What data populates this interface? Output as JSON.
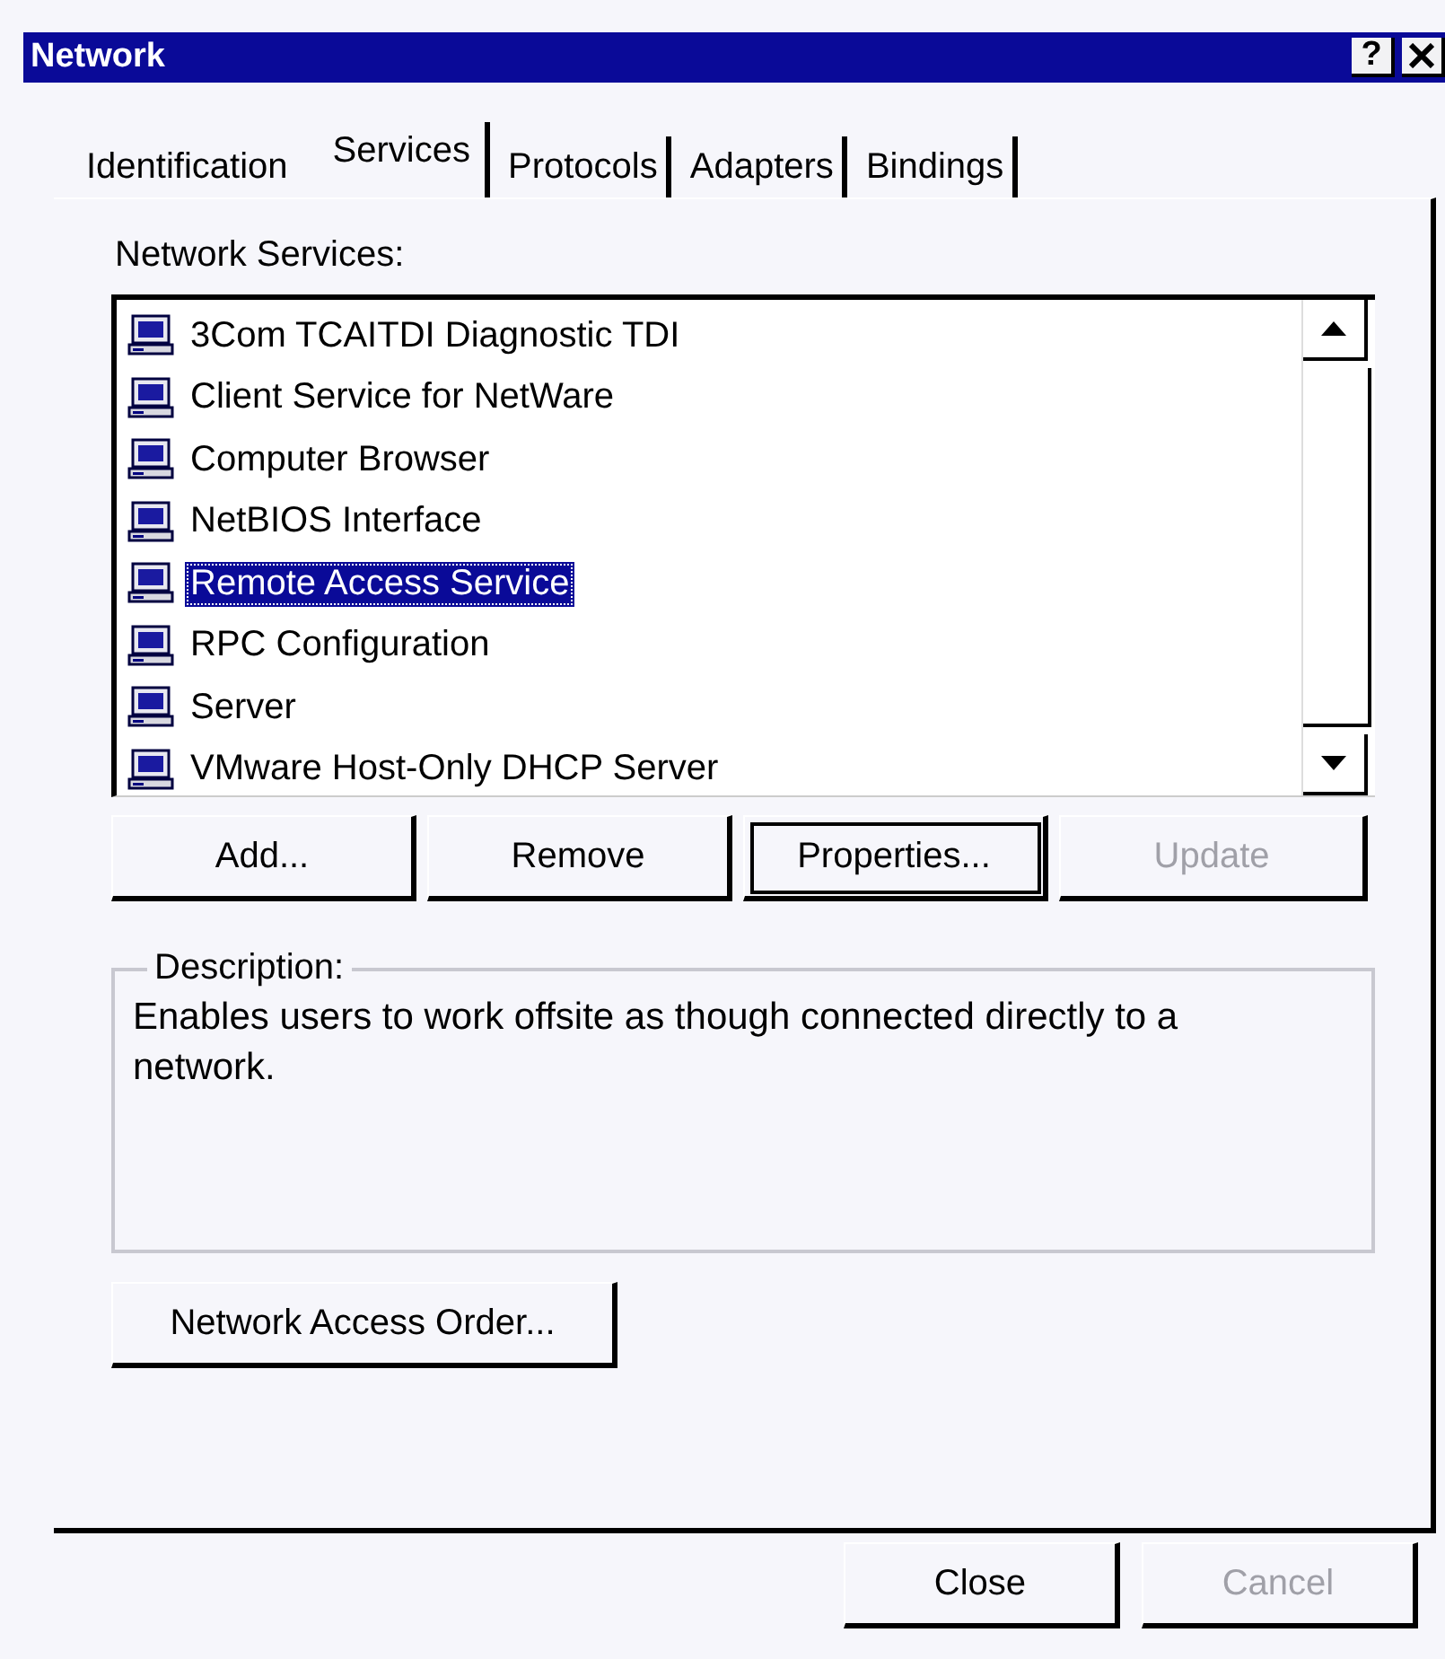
{
  "window": {
    "title": "Network",
    "title_buttons": [
      {
        "kind": "help",
        "label": "?"
      },
      {
        "kind": "close"
      }
    ]
  },
  "tabs": [
    {
      "label": "Identification",
      "selected": false
    },
    {
      "label": "Services",
      "selected": true
    },
    {
      "label": "Protocols",
      "selected": false
    },
    {
      "label": "Adapters",
      "selected": false
    },
    {
      "label": "Bindings",
      "selected": false
    }
  ],
  "services": {
    "label": "Network Services:",
    "items": [
      {
        "name": "3Com TCAITDI Diagnostic TDI",
        "selected": false
      },
      {
        "name": "Client Service for NetWare",
        "selected": false
      },
      {
        "name": "Computer Browser",
        "selected": false
      },
      {
        "name": "NetBIOS Interface",
        "selected": false
      },
      {
        "name": "Remote Access Service",
        "selected": true
      },
      {
        "name": "RPC Configuration",
        "selected": false
      },
      {
        "name": "Server",
        "selected": false
      },
      {
        "name": "VMware Host-Only DHCP Server",
        "selected": false
      }
    ]
  },
  "service_buttons": [
    {
      "label": "Add...",
      "disabled": false,
      "default": false
    },
    {
      "label": "Remove",
      "disabled": false,
      "default": false
    },
    {
      "label": "Properties...",
      "disabled": false,
      "default": true
    },
    {
      "label": "Update",
      "disabled": true,
      "default": false
    }
  ],
  "description": {
    "label": "Description:",
    "text": "Enables users to work offsite as though connected directly to a network."
  },
  "access_order_button": {
    "label": "Network Access Order...",
    "disabled": false,
    "default": false
  },
  "footer_buttons": [
    {
      "label": "Close",
      "disabled": false,
      "default": false
    },
    {
      "label": "Cancel",
      "disabled": true,
      "default": false
    }
  ]
}
